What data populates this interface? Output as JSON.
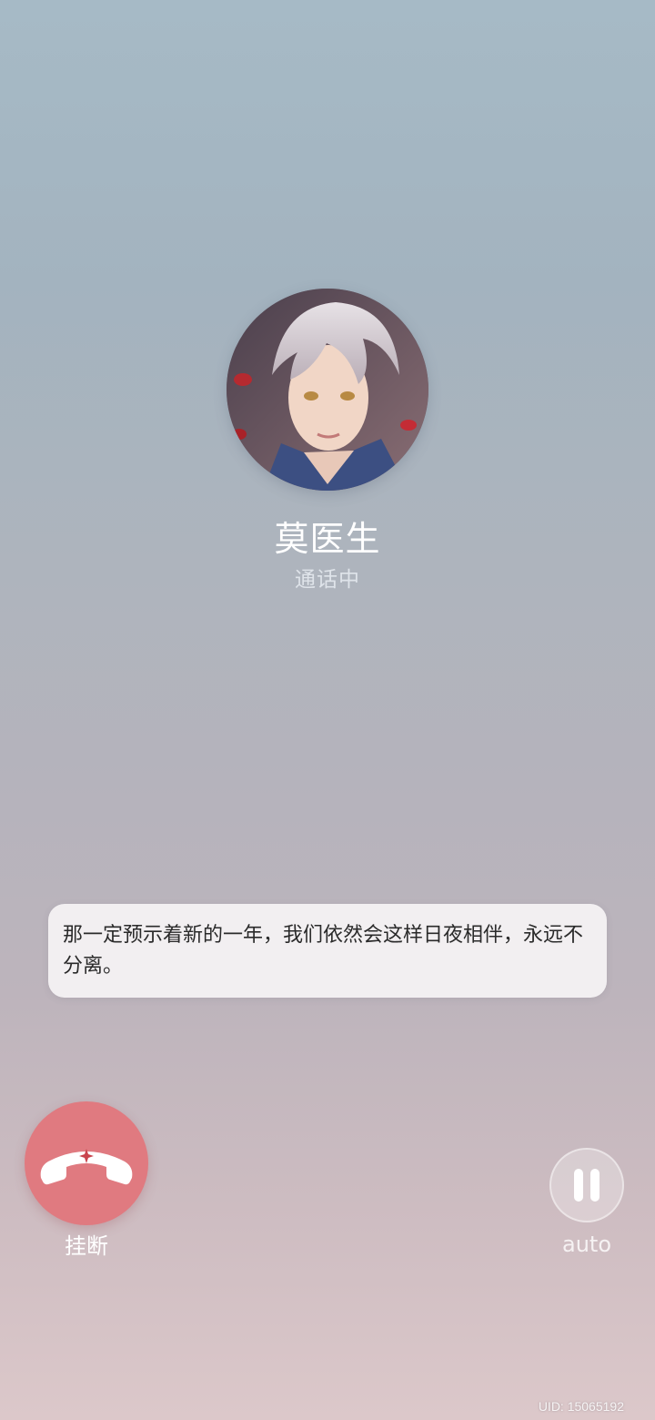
{
  "call": {
    "contact_name": "莫医生",
    "status": "通话中"
  },
  "subtitle": {
    "text": "那一定预示着新的一年，我们依然会这样日夜相伴，永远不分离。"
  },
  "controls": {
    "hangup_label": "挂断",
    "auto_label": "auto",
    "hangup_icon": "phone-hangup-icon",
    "pause_icon": "pause-icon"
  },
  "footer": {
    "uid": "UID: 15065192"
  },
  "colors": {
    "hangup_button": "#e07a80",
    "background_top": "#a6bac6",
    "background_bottom": "#dcc8ca"
  }
}
